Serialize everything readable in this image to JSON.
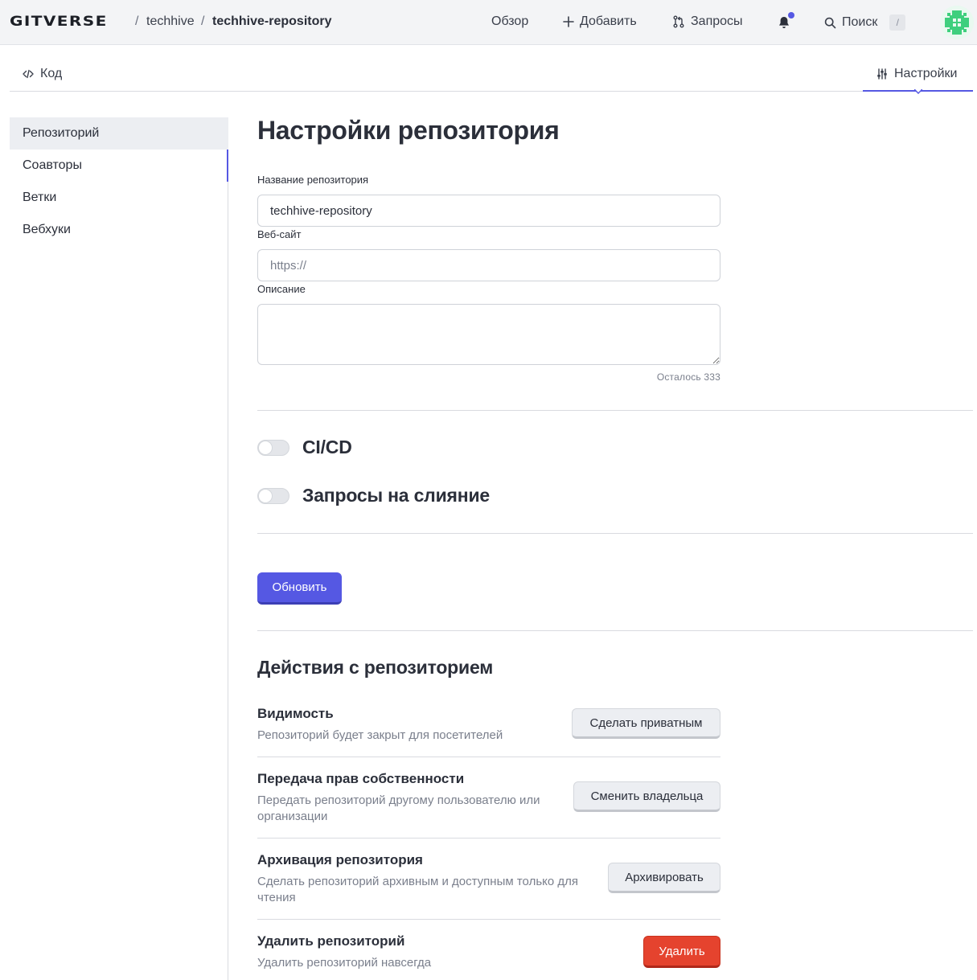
{
  "header": {
    "logo": "GITVERSE",
    "breadcrumb": [
      "techhive",
      "techhive-repository"
    ],
    "separator": "/",
    "nav": {
      "overview": "Обзор",
      "add": "Добавить",
      "requests": "Запросы",
      "search": "Поиск",
      "search_shortcut": "/"
    },
    "icons": [
      "plus-icon",
      "merge-request-icon",
      "bell-icon",
      "search-icon",
      "avatar"
    ]
  },
  "tabs": {
    "code": "Код",
    "settings": "Настройки",
    "active": "settings"
  },
  "sidebar": {
    "items": [
      {
        "label": "Репозиторий",
        "active": true
      },
      {
        "label": "Соавторы",
        "active": false
      },
      {
        "label": "Ветки",
        "active": false
      },
      {
        "label": "Вебхуки",
        "active": false
      }
    ]
  },
  "form": {
    "title": "Настройки репозитория",
    "name_label": "Название репозитория",
    "name_value": "techhive-repository",
    "website_label": "Веб-сайт",
    "website_placeholder": "https://",
    "description_label": "Описание",
    "description_value": "",
    "remaining": "Осталось 333",
    "toggles": {
      "cicd": {
        "label": "CI/CD",
        "enabled": false
      },
      "merge_requests": {
        "label": "Запросы на слияние",
        "enabled": false
      }
    },
    "submit": "Обновить"
  },
  "actions": {
    "title": "Действия с репозиторием",
    "items": [
      {
        "title": "Видимость",
        "description": "Репозиторий будет закрыт для посетителей",
        "button": "Сделать приватным"
      },
      {
        "title": "Передача прав собственности",
        "description": "Передать репозиторий другому пользователю или организации",
        "button": "Сменить владельца"
      },
      {
        "title": "Архивация репозитория",
        "description": "Сделать репозиторий архивным и доступным только для чтения",
        "button": "Архивировать"
      },
      {
        "title": "Удалить репозиторий",
        "description": "Удалить репозиторий навсегда",
        "button": "Удалить"
      }
    ]
  },
  "colors": {
    "accent": "#5558e3",
    "danger": "#e5432e",
    "header_bg": "#f3f4f6",
    "muted_text": "#7a7f8c"
  }
}
